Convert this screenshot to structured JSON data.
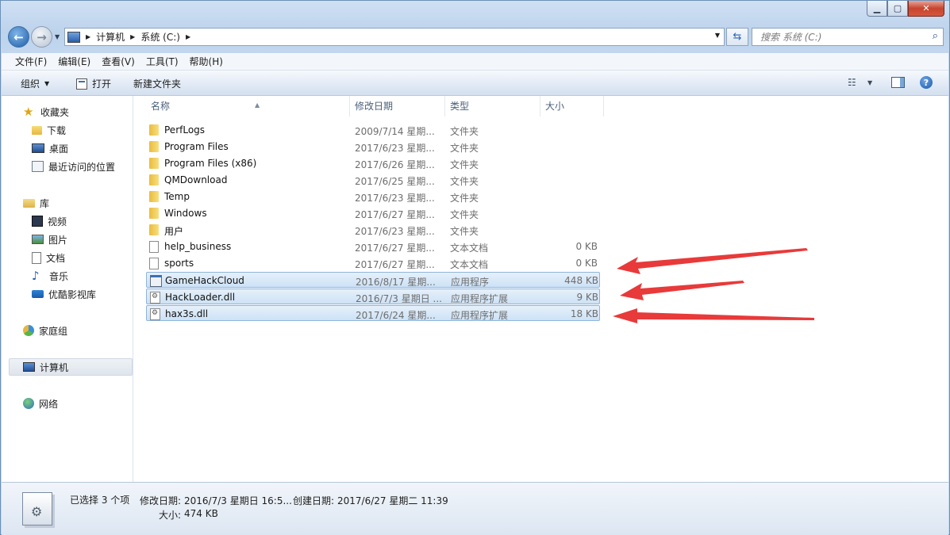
{
  "window": {
    "controls": {
      "minimize": "▁",
      "maximize": "▢",
      "close": "✕"
    }
  },
  "address": {
    "crumbs": [
      "计算机",
      "系统 (C:)"
    ],
    "search_placeholder": "搜索 系统 (C:)"
  },
  "menu": [
    "文件(F)",
    "编辑(E)",
    "查看(V)",
    "工具(T)",
    "帮助(H)"
  ],
  "toolbar": {
    "organize": "组织",
    "open": "打开",
    "new_folder": "新建文件夹"
  },
  "nav_pane": {
    "favorites": {
      "label": "收藏夹",
      "items": [
        "下载",
        "桌面",
        "最近访问的位置"
      ]
    },
    "libraries": {
      "label": "库",
      "items": [
        "视频",
        "图片",
        "文档",
        "音乐",
        "优酷影视库"
      ]
    },
    "homegroup": "家庭组",
    "computer": "计算机",
    "network": "网络"
  },
  "columns": {
    "name": "名称",
    "date": "修改日期",
    "type": "类型",
    "size": "大小"
  },
  "files": [
    {
      "icon": "folder-icon",
      "name": "PerfLogs",
      "date": "2009/7/14 星期...",
      "type": "文件夹",
      "size": "",
      "selected": false
    },
    {
      "icon": "folder-icon",
      "name": "Program Files",
      "date": "2017/6/23 星期...",
      "type": "文件夹",
      "size": "",
      "selected": false
    },
    {
      "icon": "folder-icon",
      "name": "Program Files (x86)",
      "date": "2017/6/26 星期...",
      "type": "文件夹",
      "size": "",
      "selected": false
    },
    {
      "icon": "folder-icon",
      "name": "QMDownload",
      "date": "2017/6/25 星期...",
      "type": "文件夹",
      "size": "",
      "selected": false
    },
    {
      "icon": "folder-icon",
      "name": "Temp",
      "date": "2017/6/23 星期...",
      "type": "文件夹",
      "size": "",
      "selected": false
    },
    {
      "icon": "folder-icon",
      "name": "Windows",
      "date": "2017/6/27 星期...",
      "type": "文件夹",
      "size": "",
      "selected": false
    },
    {
      "icon": "folder-icon",
      "name": "用户",
      "date": "2017/6/23 星期...",
      "type": "文件夹",
      "size": "",
      "selected": false
    },
    {
      "icon": "text-file-icon",
      "name": "help_business",
      "date": "2017/6/27 星期...",
      "type": "文本文档",
      "size": "0 KB",
      "selected": false
    },
    {
      "icon": "text-file-icon",
      "name": "sports",
      "date": "2017/6/27 星期...",
      "type": "文本文档",
      "size": "0 KB",
      "selected": false
    },
    {
      "icon": "exe-file-icon",
      "name": "GameHackCloud",
      "date": "2016/8/17 星期...",
      "type": "应用程序",
      "size": "448 KB",
      "selected": true
    },
    {
      "icon": "dll-file-icon",
      "name": "HackLoader.dll",
      "date": "2016/7/3 星期日 ...",
      "type": "应用程序扩展",
      "size": "9 KB",
      "selected": true
    },
    {
      "icon": "dll-file-icon",
      "name": "hax3s.dll",
      "date": "2017/6/24 星期...",
      "type": "应用程序扩展",
      "size": "18 KB",
      "selected": true
    }
  ],
  "status": {
    "selected_count": "已选择 3 个项",
    "modified_label": "修改日期:",
    "modified_value": "2016/7/3 星期日 16:5...",
    "created_label": "创建日期:",
    "created_value": "2017/6/27 星期二 11:39",
    "size_label": "大小:",
    "size_value": "474 KB"
  },
  "colors": {
    "accent_arrow": "#e83a3a",
    "selection": "#cde2f6"
  }
}
